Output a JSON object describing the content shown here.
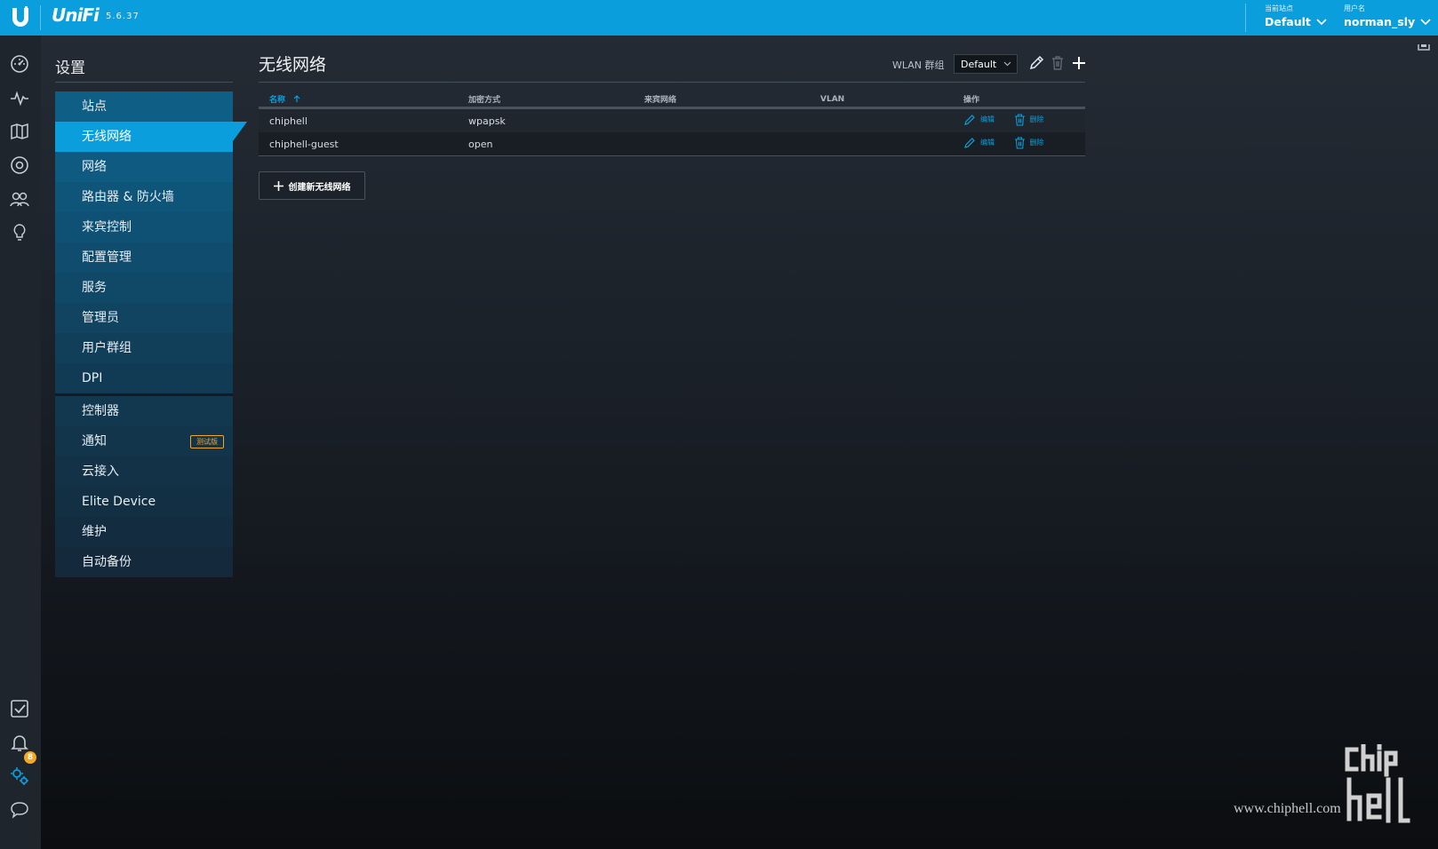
{
  "header": {
    "brand": "UniFi",
    "version": "5.6.37",
    "site_label": "当前站点",
    "site_value": "Default",
    "user_label": "用户名",
    "user_value": "norman_sly"
  },
  "rail": {
    "icons": [
      "dashboard-icon",
      "statistics-icon",
      "map-icon",
      "devices-icon",
      "clients-icon",
      "insights-icon",
      "events-icon",
      "alerts-icon",
      "settings-icon",
      "chat-icon"
    ],
    "alerts_badge": "8",
    "accent": "#0a9fdc"
  },
  "settings": {
    "title": "设置",
    "items": [
      "站点",
      "无线网络",
      "网络",
      "路由器 & 防火墙",
      "来宾控制",
      "配置管理",
      "服务",
      "管理员",
      "用户群组",
      "DPI"
    ],
    "items2": [
      "控制器",
      "通知",
      "云接入",
      "Elite Device",
      "维护",
      "自动备份"
    ],
    "beta_label": "测试版"
  },
  "main": {
    "title": "无线网络",
    "wlan_group_label": "WLAN 群组",
    "wlan_group_value": "Default",
    "columns": [
      "名称",
      "加密方式",
      "来宾网络",
      "VLAN",
      "操作"
    ],
    "rows": [
      {
        "name": "chiphell",
        "security": "wpapsk",
        "guest": "",
        "vlan": ""
      },
      {
        "name": "chiphell-guest",
        "security": "open",
        "guest": "",
        "vlan": ""
      }
    ],
    "edit_label": "编辑",
    "delete_label": "删除",
    "create_label": "创建新无线网络"
  },
  "watermark": {
    "url": "www.chiphell.com"
  }
}
